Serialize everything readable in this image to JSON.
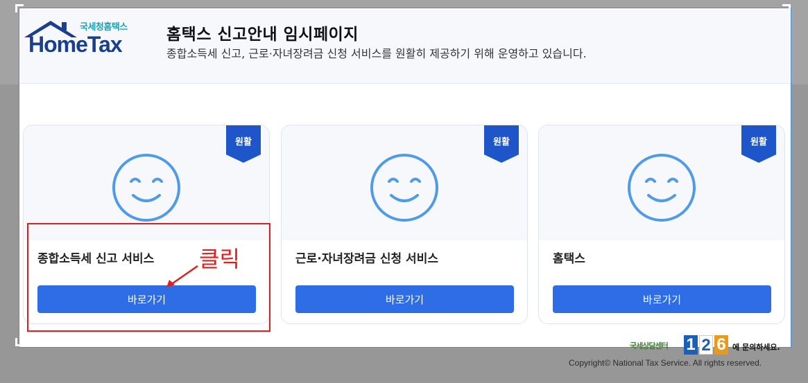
{
  "logo": {
    "subtitle": "국세청홈택스",
    "wordmark": "HomeTax",
    "roof_icon": "house-roof-icon"
  },
  "header": {
    "title": "홈택스 신고안내 임시페이지",
    "description": "종합소득세 신고, 근로·자녀장려금 신청 서비스를 원활히 제공하기 위해 운영하고 있습니다."
  },
  "cards": [
    {
      "badge": "원활",
      "icon": "smiley-face-icon",
      "title": "종합소득세 신고 서비스",
      "button": "바로가기"
    },
    {
      "badge": "원활",
      "icon": "smiley-face-icon",
      "title": "근로·자녀장려금 신청 서비스",
      "button": "바로가기"
    },
    {
      "badge": "원활",
      "icon": "smiley-face-icon",
      "title": "홈택스",
      "button": "바로가기"
    }
  ],
  "annotation": {
    "text": "클릭",
    "arrow_icon": "red-arrow-icon",
    "color": "#e11d1d"
  },
  "footer": {
    "helpdesk_prefix": "국세상담센터",
    "helpdesk_digits": [
      "1",
      "2",
      "6"
    ],
    "helpdesk_suffix": "에 문의하세요.",
    "copyright": "Copyright© National Tax Service. All rights reserved."
  },
  "colors": {
    "accent_blue": "#2f6de6",
    "badge_blue": "#1e56c9",
    "face_blue": "#4f9be8",
    "logo_navy": "#1a3f8e",
    "logo_teal": "#1aa3b8"
  }
}
